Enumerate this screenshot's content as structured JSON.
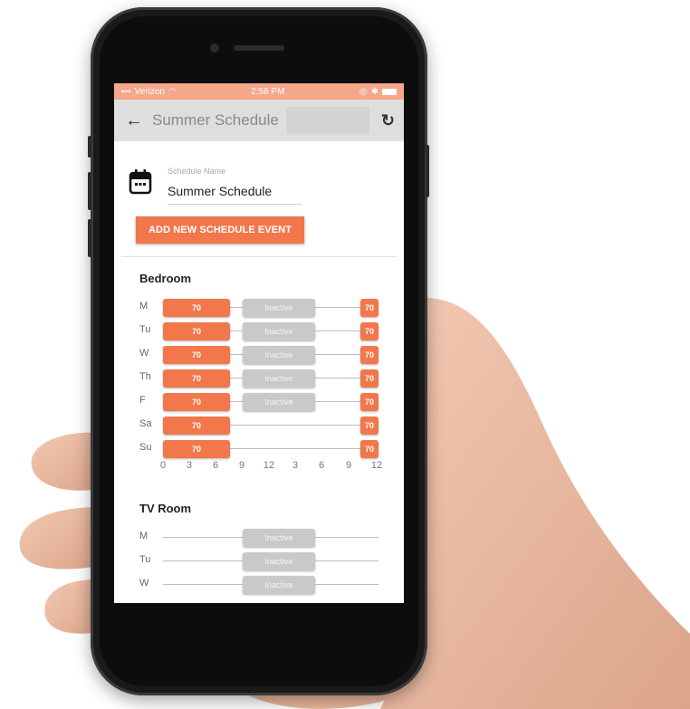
{
  "status_bar": {
    "carrier": "Verizon",
    "time": "2:58 PM"
  },
  "app_bar": {
    "title": "Summer Schedule",
    "back_icon": "arrow-left-icon",
    "refresh_icon": "refresh-icon"
  },
  "schedule": {
    "name_label": "Schedule Name",
    "name_value": "Summer Schedule",
    "add_button": "ADD NEW SCHEDULE EVENT"
  },
  "colors": {
    "accent": "#f2774b",
    "inactive": "#c9c9c9",
    "status_bar": "#f5a78a"
  },
  "axis_ticks": [
    "0",
    "3",
    "6",
    "9",
    "12",
    "3",
    "6",
    "9",
    "12"
  ],
  "rooms": [
    {
      "name": "Bedroom",
      "days": [
        {
          "day": "M",
          "segments": [
            {
              "label": "70",
              "state": "active"
            },
            {
              "label": "Inactive",
              "state": "inactive"
            },
            {
              "label": "70",
              "state": "active"
            }
          ]
        },
        {
          "day": "Tu",
          "segments": [
            {
              "label": "70",
              "state": "active"
            },
            {
              "label": "Inactive",
              "state": "inactive"
            },
            {
              "label": "70",
              "state": "active"
            }
          ]
        },
        {
          "day": "W",
          "segments": [
            {
              "label": "70",
              "state": "active"
            },
            {
              "label": "Inactive",
              "state": "inactive"
            },
            {
              "label": "70",
              "state": "active"
            }
          ]
        },
        {
          "day": "Th",
          "segments": [
            {
              "label": "70",
              "state": "active"
            },
            {
              "label": "Inactive",
              "state": "inactive"
            },
            {
              "label": "70",
              "state": "active"
            }
          ]
        },
        {
          "day": "F",
          "segments": [
            {
              "label": "70",
              "state": "active"
            },
            {
              "label": "Inactive",
              "state": "inactive"
            },
            {
              "label": "70",
              "state": "active"
            }
          ]
        },
        {
          "day": "Sa",
          "segments": [
            {
              "label": "70",
              "state": "active"
            },
            {
              "label": "70",
              "state": "active"
            }
          ]
        },
        {
          "day": "Su",
          "segments": [
            {
              "label": "70",
              "state": "active"
            },
            {
              "label": "70",
              "state": "active"
            }
          ]
        }
      ]
    },
    {
      "name": "TV Room",
      "days": [
        {
          "day": "M",
          "segments": [
            {
              "label": "Inactive",
              "state": "inactive"
            }
          ]
        },
        {
          "day": "Tu",
          "segments": [
            {
              "label": "Inactive",
              "state": "inactive"
            }
          ]
        },
        {
          "day": "W",
          "segments": [
            {
              "label": "Inactive",
              "state": "inactive"
            }
          ]
        }
      ]
    }
  ]
}
